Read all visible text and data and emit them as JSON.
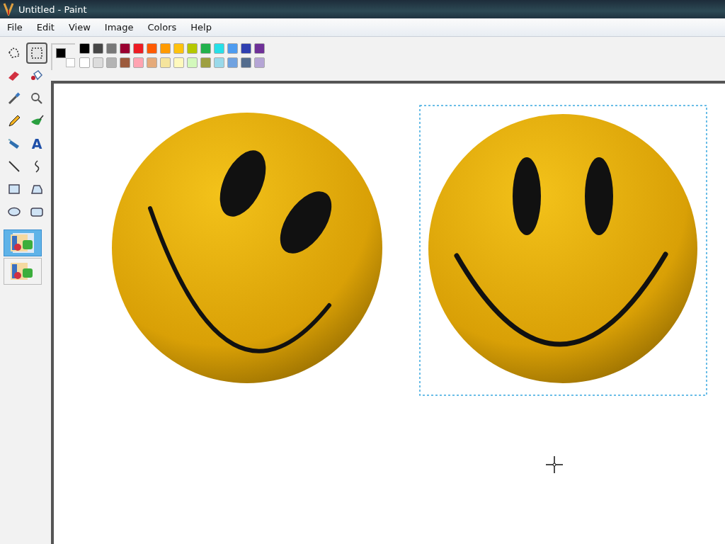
{
  "window": {
    "title": "Untitled - Paint"
  },
  "menu": [
    "File",
    "Edit",
    "View",
    "Image",
    "Colors",
    "Help"
  ],
  "tools": [
    {
      "kind": "free-select",
      "selected": false
    },
    {
      "kind": "select",
      "selected": true
    },
    {
      "kind": "eraser",
      "selected": false
    },
    {
      "kind": "fill",
      "selected": false
    },
    {
      "kind": "picker",
      "selected": false
    },
    {
      "kind": "magnifier",
      "selected": false
    },
    {
      "kind": "pencil",
      "selected": false
    },
    {
      "kind": "brush",
      "selected": false
    },
    {
      "kind": "airbrush",
      "selected": false
    },
    {
      "kind": "text",
      "label": "A",
      "selected": false
    },
    {
      "kind": "line",
      "selected": false
    },
    {
      "kind": "curve",
      "selected": false
    },
    {
      "kind": "rectangle",
      "selected": false
    },
    {
      "kind": "polygon",
      "selected": false
    },
    {
      "kind": "ellipse",
      "selected": false
    },
    {
      "kind": "rounded-rectangle",
      "selected": false
    }
  ],
  "tool_options": [
    {
      "kind": "opaque",
      "selected": true
    },
    {
      "kind": "transparent",
      "selected": false
    }
  ],
  "current_colors": [
    {
      "kind": "foreground",
      "color": "#000000"
    },
    {
      "kind": "background",
      "color": "#ffffff"
    }
  ],
  "palette": [
    {
      "color": "#000000"
    },
    {
      "color": "#464646"
    },
    {
      "color": "#787878"
    },
    {
      "color": "#990030"
    },
    {
      "color": "#ed1c24"
    },
    {
      "color": "#ff5a00"
    },
    {
      "color": "#ff9a00"
    },
    {
      "color": "#ffc20e"
    },
    {
      "color": "#b5c800"
    },
    {
      "color": "#22b14c"
    },
    {
      "color": "#26e0e8"
    },
    {
      "color": "#4d9bf0"
    },
    {
      "color": "#2f3fb0"
    },
    {
      "color": "#6f3198"
    },
    {
      "color": "#ffffff"
    },
    {
      "color": "#dcdcdc"
    },
    {
      "color": "#b4b4b4"
    },
    {
      "color": "#9c5a3c"
    },
    {
      "color": "#ffa3b1"
    },
    {
      "color": "#e5aa7a"
    },
    {
      "color": "#f5e49c"
    },
    {
      "color": "#fff9bd"
    },
    {
      "color": "#d3f9bc"
    },
    {
      "color": "#9d9f40"
    },
    {
      "color": "#99d9ea"
    },
    {
      "color": "#70a2e0"
    },
    {
      "color": "#546d8e"
    },
    {
      "color": "#b5a5d5"
    }
  ]
}
